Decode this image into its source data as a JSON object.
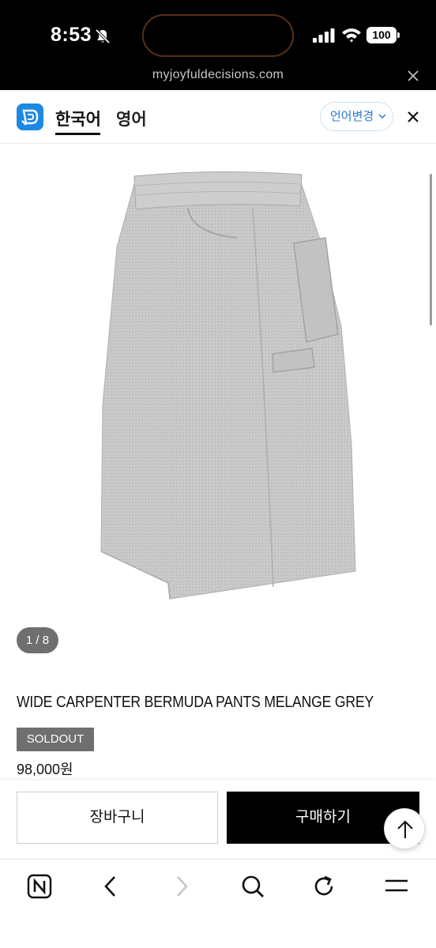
{
  "status_bar": {
    "time": "8:53",
    "battery": "100",
    "icons": [
      "bell-slash-icon",
      "cellular-signal-icon",
      "wifi-icon",
      "battery-icon"
    ]
  },
  "browser": {
    "url": "myjoyfuldecisions.com"
  },
  "translate_bar": {
    "source_language": "한국어",
    "target_language": "영어",
    "change_language_label": "언어변경",
    "accent_color": "#1e88e5"
  },
  "product": {
    "image_counter": "1 / 8",
    "title": "WIDE CARPENTER BERMUDA PANTS MELANGE GREY",
    "status_badge": "SOLDOUT",
    "price": "98,000원"
  },
  "actions": {
    "cart_label": "장바구니",
    "buy_label": "구매하기"
  },
  "toolbar": {
    "icons": [
      "naver-icon",
      "back-icon",
      "forward-icon",
      "search-icon",
      "reload-icon",
      "menu-icon"
    ]
  }
}
